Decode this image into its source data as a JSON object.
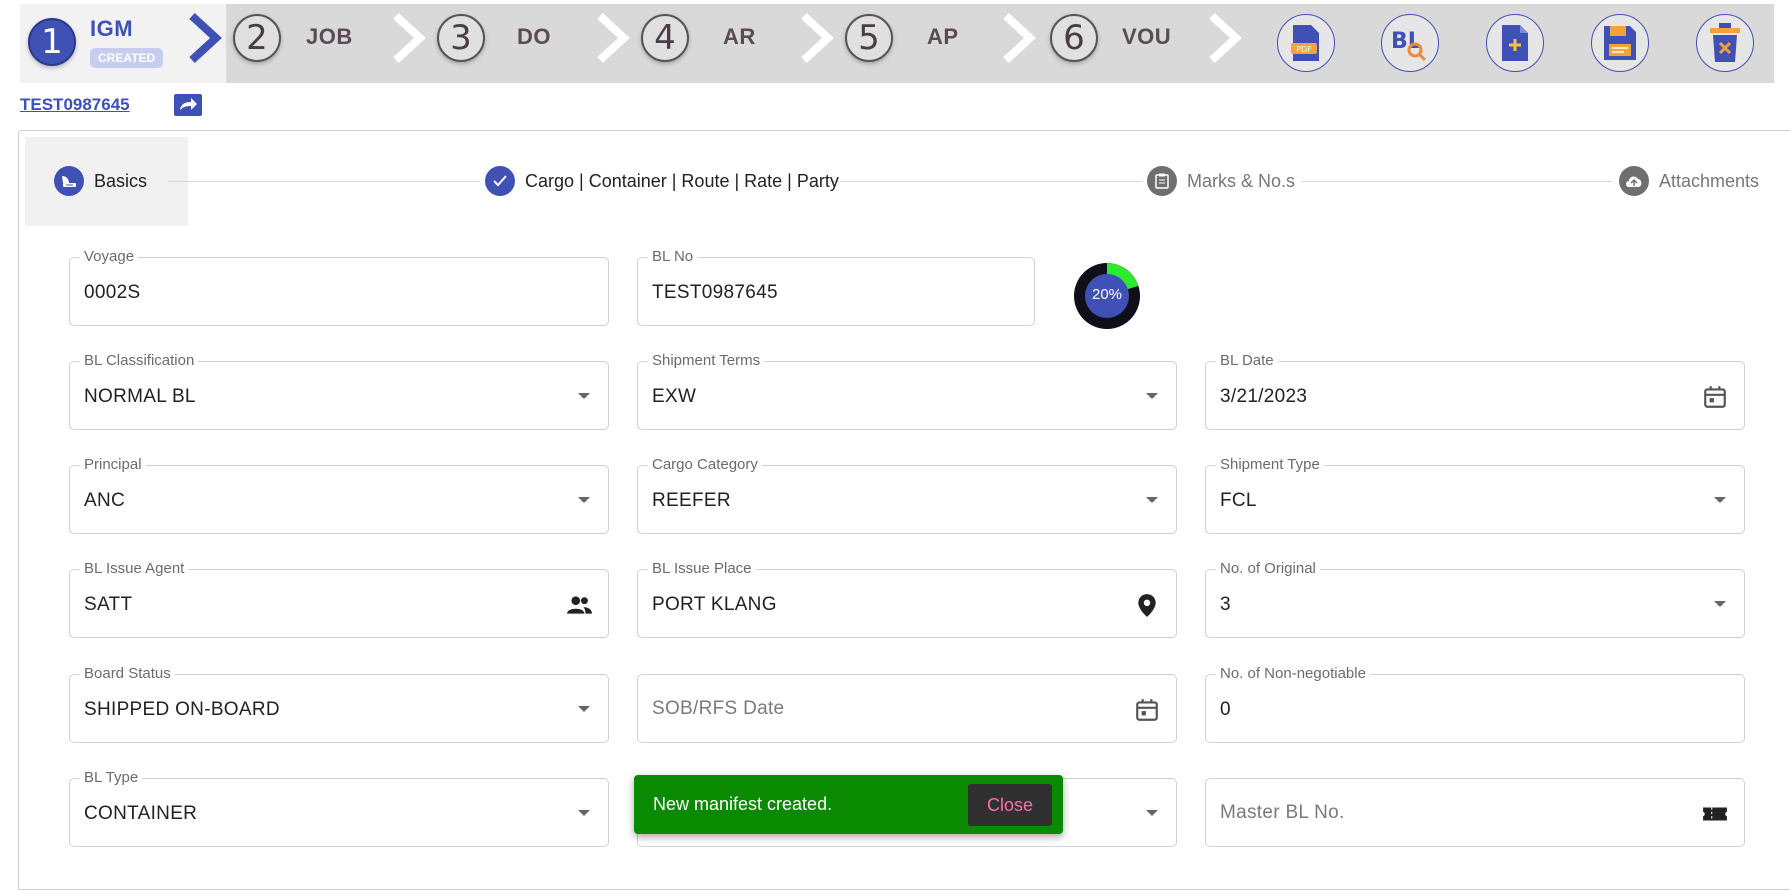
{
  "process_bar": {
    "steps": [
      {
        "number": "1",
        "label": "IGM",
        "badge": "CREATED"
      },
      {
        "number": "2",
        "label": "JOB"
      },
      {
        "number": "3",
        "label": "DO"
      },
      {
        "number": "4",
        "label": "AR"
      },
      {
        "number": "5",
        "label": "AP"
      },
      {
        "number": "6",
        "label": "VOU"
      }
    ],
    "actions": [
      "pdf-icon",
      "bl-search-icon",
      "new-document-icon",
      "save-icon",
      "delete-icon"
    ]
  },
  "reference": {
    "number": "TEST0987645"
  },
  "stepper": {
    "items": [
      {
        "label": "Basics",
        "icon": "basics-icon"
      },
      {
        "label": "Cargo | Container | Route | Rate | Party",
        "icon": "check-icon"
      },
      {
        "label": "Marks & No.s",
        "icon": "clipboard-icon"
      },
      {
        "label": "Attachments",
        "icon": "cloud-upload-icon"
      }
    ]
  },
  "form": {
    "voyage": {
      "label": "Voyage",
      "value": "0002S"
    },
    "bl_no": {
      "label": "BL No",
      "value": "TEST0987645"
    },
    "progress": {
      "text": "20%",
      "value": 0.2
    },
    "bl_classification": {
      "label": "BL Classification",
      "value": "NORMAL BL"
    },
    "shipment_terms": {
      "label": "Shipment Terms",
      "value": "EXW"
    },
    "bl_date": {
      "label": "BL Date",
      "value": "3/21/2023"
    },
    "principal": {
      "label": "Principal",
      "value": "ANC"
    },
    "cargo_category": {
      "label": "Cargo Category",
      "value": "REEFER"
    },
    "shipment_type": {
      "label": "Shipment Type",
      "value": "FCL"
    },
    "bl_issue_agent": {
      "label": "BL Issue Agent",
      "value": "SATT"
    },
    "bl_issue_place": {
      "label": "BL Issue Place",
      "value": "PORT KLANG"
    },
    "no_of_original": {
      "label": "No. of Original",
      "value": "3"
    },
    "board_status": {
      "label": "Board Status",
      "value": "SHIPPED ON-BOARD"
    },
    "sob_rfs_date": {
      "placeholder": "SOB/RFS Date"
    },
    "no_of_non_negotiable": {
      "label": "No. of Non-negotiable",
      "value": "0"
    },
    "bl_type": {
      "label": "BL Type",
      "value": "CONTAINER"
    },
    "master_bl_no": {
      "placeholder": "Master BL No."
    }
  },
  "snackbar": {
    "message": "New manifest created.",
    "close_label": "Close"
  },
  "colors": {
    "primary": "#3f51b5",
    "success": "#0a8a00",
    "progress": "#2eea2e",
    "close_text": "#ff6fa8"
  }
}
